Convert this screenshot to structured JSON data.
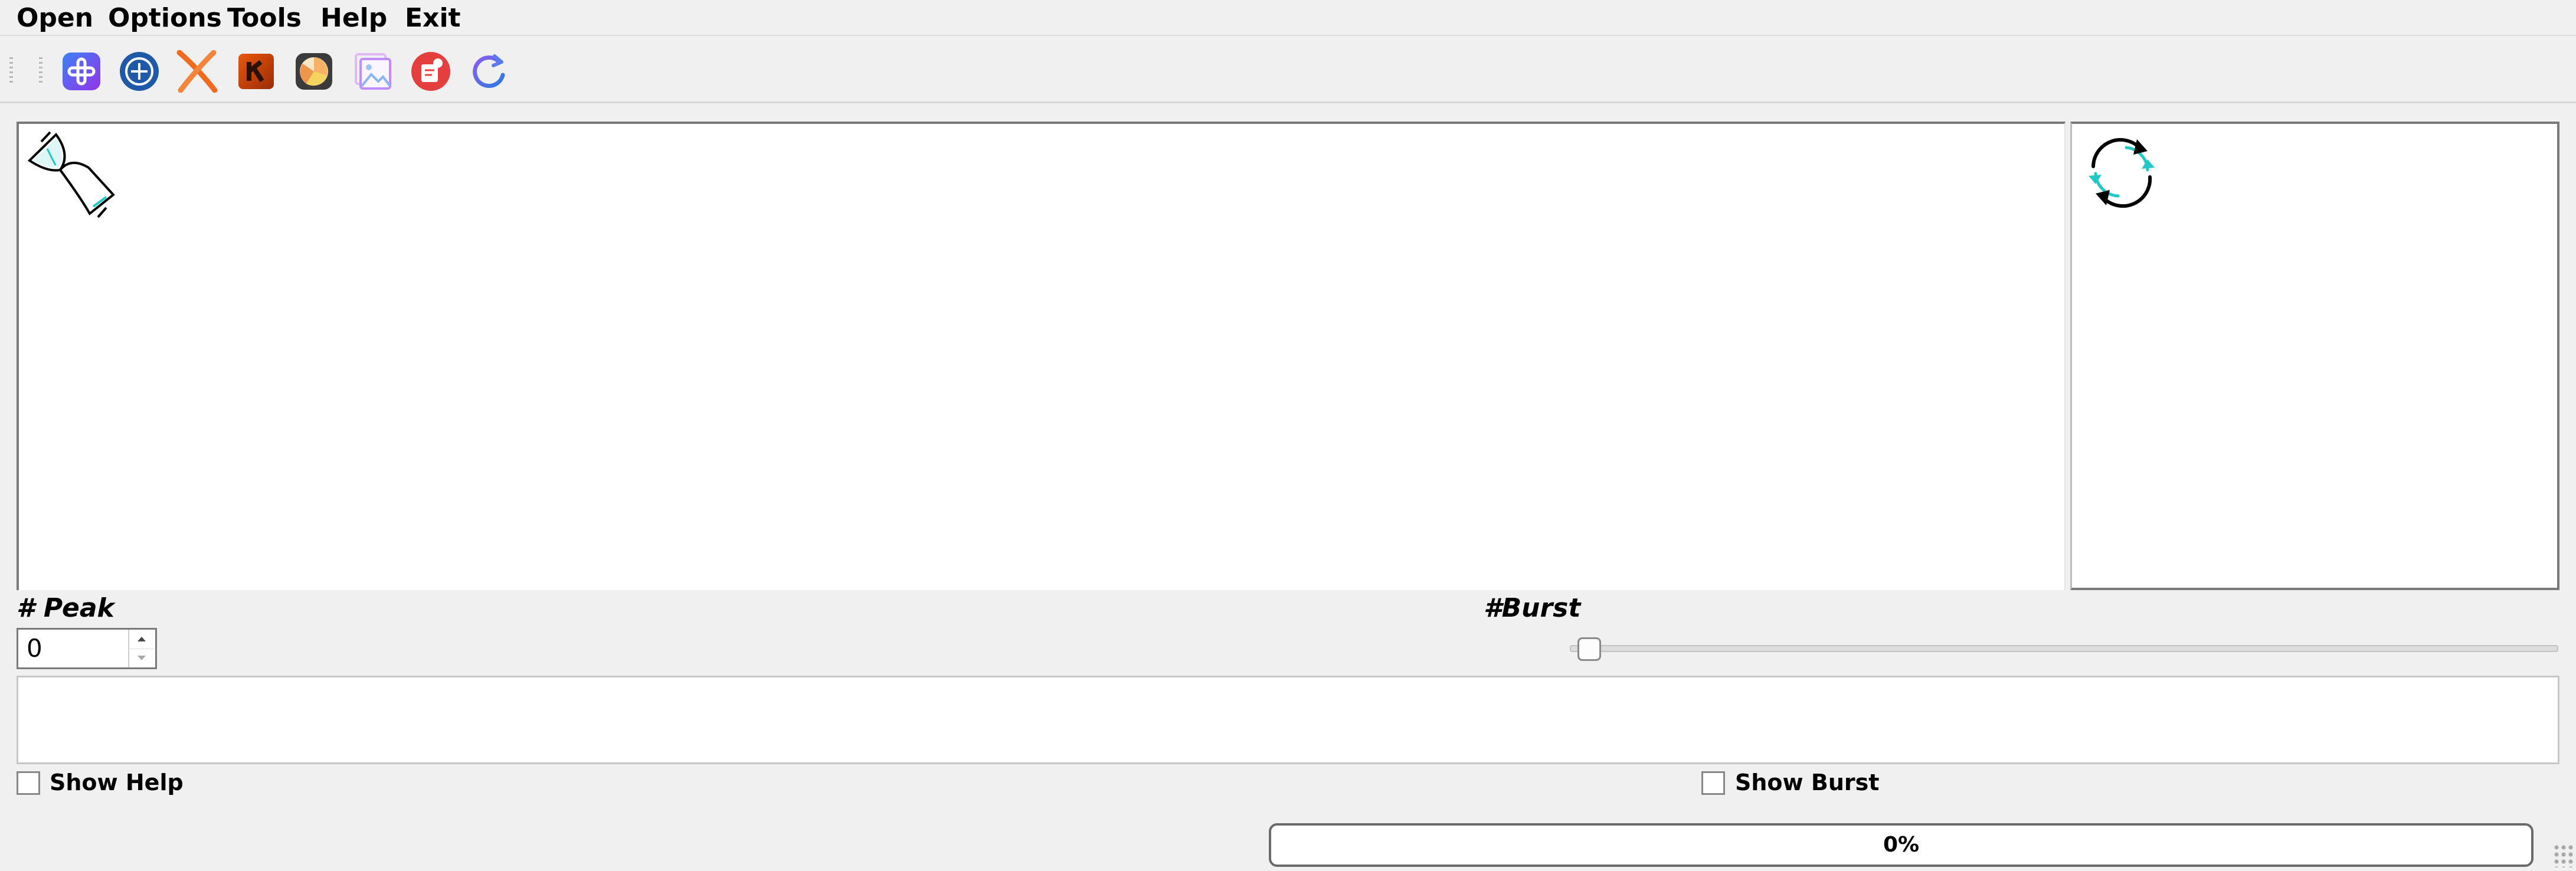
{
  "menu": {
    "open": "Open",
    "options": "Options",
    "tools": "Tools",
    "help": "Help",
    "exit": "Exit"
  },
  "toolbar": {
    "buttons": [
      {
        "icon": "add-icon",
        "color": "#5b4ef5"
      },
      {
        "icon": "circle-plus-icon",
        "color": "#1e5aa8"
      },
      {
        "icon": "close-x-icon",
        "color": "#f26b1d"
      },
      {
        "icon": "k-logo-icon",
        "color": "#c2410c"
      },
      {
        "icon": "chart-disc-icon",
        "color": "#ef8a3a"
      },
      {
        "icon": "image-gallery-icon",
        "color": "#c08cff"
      },
      {
        "icon": "sticker-icon",
        "color": "#e53e3e"
      },
      {
        "icon": "refresh-icon",
        "color": "#2b7be0"
      }
    ]
  },
  "canvas": {
    "icon": "hourglass-loading-icon"
  },
  "side_panel": {
    "icon": "sync-arrows-icon",
    "accent": "#22c7c7"
  },
  "peak": {
    "label": "# Peak",
    "value": "0"
  },
  "burst": {
    "label": "#Burst",
    "slider_fraction": 0
  },
  "options": {
    "show_help": "Show Help",
    "show_burst": "Show Burst"
  },
  "progress": {
    "text": "0%",
    "fraction": 0
  }
}
